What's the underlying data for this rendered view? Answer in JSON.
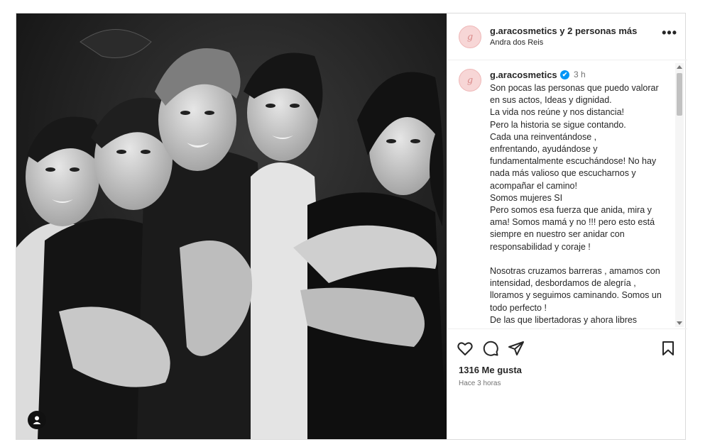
{
  "header": {
    "collab_title": "g.aracosmetics y 2 personas más",
    "subtitle": "Andra dos Reis",
    "more_icon": "more-horizontal-icon",
    "avatar_monogram": "g"
  },
  "caption": {
    "username": "g.aracosmetics",
    "verified_icon": "✔",
    "time": "3 h",
    "text": "Son pocas las personas que puedo valorar en sus actos, Ideas y dignidad.\nLa vida nos reúne y nos distancia!\nPero la historia se sigue contando.\nCada una reinventándose ,\nenfrentando, ayudándose y fundamentalmente escuchándose! No hay nada más valioso que escucharnos y acompañar el camino!\nSomos mujeres SI\nPero somos esa fuerza que anida, mira y ama! Somos mamá y no !!! pero esto está siempre en nuestro ser anidar con responsabilidad y coraje !\n\nNosotras cruzamos barreras , amamos con intensidad, desbordamos de alegría , lloramos y seguimos caminando. Somos un todo perfecto !\nDe las que libertadoras y ahora libres"
  },
  "actions": {
    "like_icon": "heart-icon",
    "comment_icon": "comment-icon",
    "share_icon": "share-icon",
    "save_icon": "bookmark-icon"
  },
  "likes": "1316 Me gusta",
  "posted_ago": "Hace 3 horas",
  "colors": {
    "verified": "#0095f6",
    "avatar_bg": "#f7d6d6",
    "border": "#dbdbdb"
  }
}
